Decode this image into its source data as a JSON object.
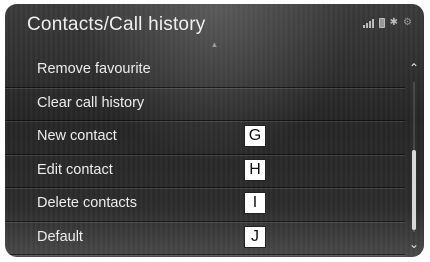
{
  "header": {
    "title": "Contacts/Call history",
    "status_icons": [
      "signal-icon",
      "battery-icon",
      "bluetooth-icon",
      "settings-icon"
    ]
  },
  "menu": {
    "items": [
      {
        "label": "Remove favourite",
        "callout": ""
      },
      {
        "label": "Clear call history",
        "callout": ""
      },
      {
        "label": "New contact",
        "callout": "G"
      },
      {
        "label": "Edit contact",
        "callout": "H"
      },
      {
        "label": "Delete contacts",
        "callout": "I"
      },
      {
        "label": "Default",
        "callout": "J"
      }
    ]
  },
  "colors": {
    "background": "#2c2c2c",
    "text": "#ededed",
    "callout_bg": "#ffffff"
  }
}
